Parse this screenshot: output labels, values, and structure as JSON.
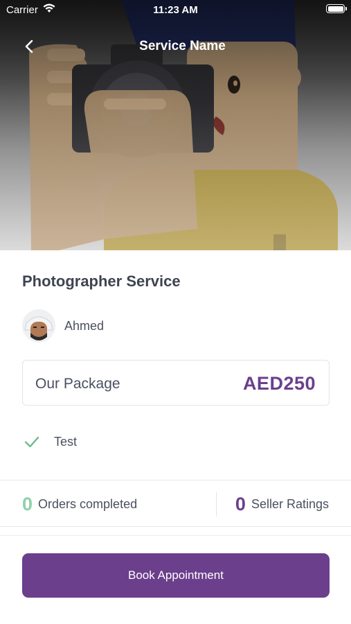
{
  "status_bar": {
    "carrier": "Carrier",
    "time": "11:23 AM"
  },
  "nav": {
    "title": "Service Name"
  },
  "service": {
    "title": "Photographer Service"
  },
  "seller": {
    "name": "Ahmed"
  },
  "package": {
    "label": "Our Package",
    "price": "AED250"
  },
  "features": [
    {
      "label": "Test"
    }
  ],
  "stats": {
    "orders_count": "0",
    "orders_label": "Orders completed",
    "ratings_count": "0",
    "ratings_label": "Seller Ratings"
  },
  "actions": {
    "book_label": "Book Appointment"
  },
  "colors": {
    "brand_purple": "#6b3f8c",
    "success_green": "#8fd0aa",
    "text_dark": "#3f4452"
  },
  "icons": {
    "back": "chevron-left-icon",
    "check": "check-icon",
    "wifi": "wifi-icon",
    "battery": "battery-icon"
  }
}
